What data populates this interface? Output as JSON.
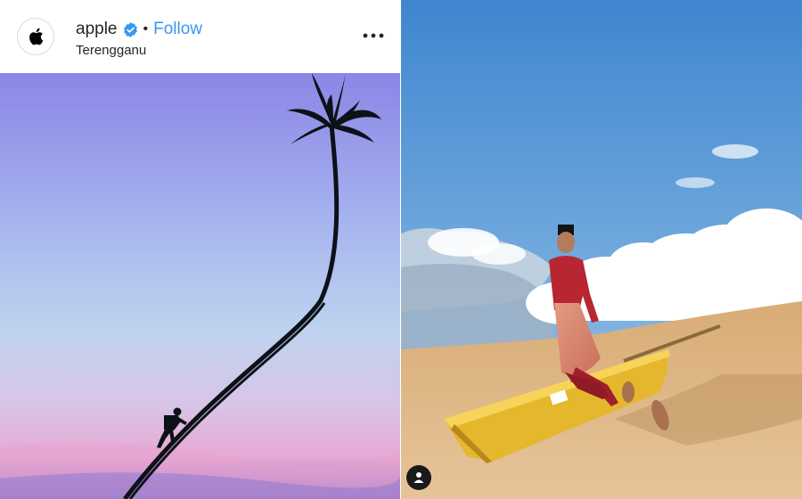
{
  "post": {
    "username": "apple",
    "separator": "•",
    "follow_label": "Follow",
    "location": "Terengganu",
    "verified": true
  },
  "icons": {
    "avatar": "apple-logo-icon",
    "verified": "verified-badge-icon",
    "more": "more-options-icon",
    "user_tag": "user-tag-icon"
  },
  "colors": {
    "follow": "#3897f0",
    "verified": "#3897f0",
    "text": "#262626"
  }
}
